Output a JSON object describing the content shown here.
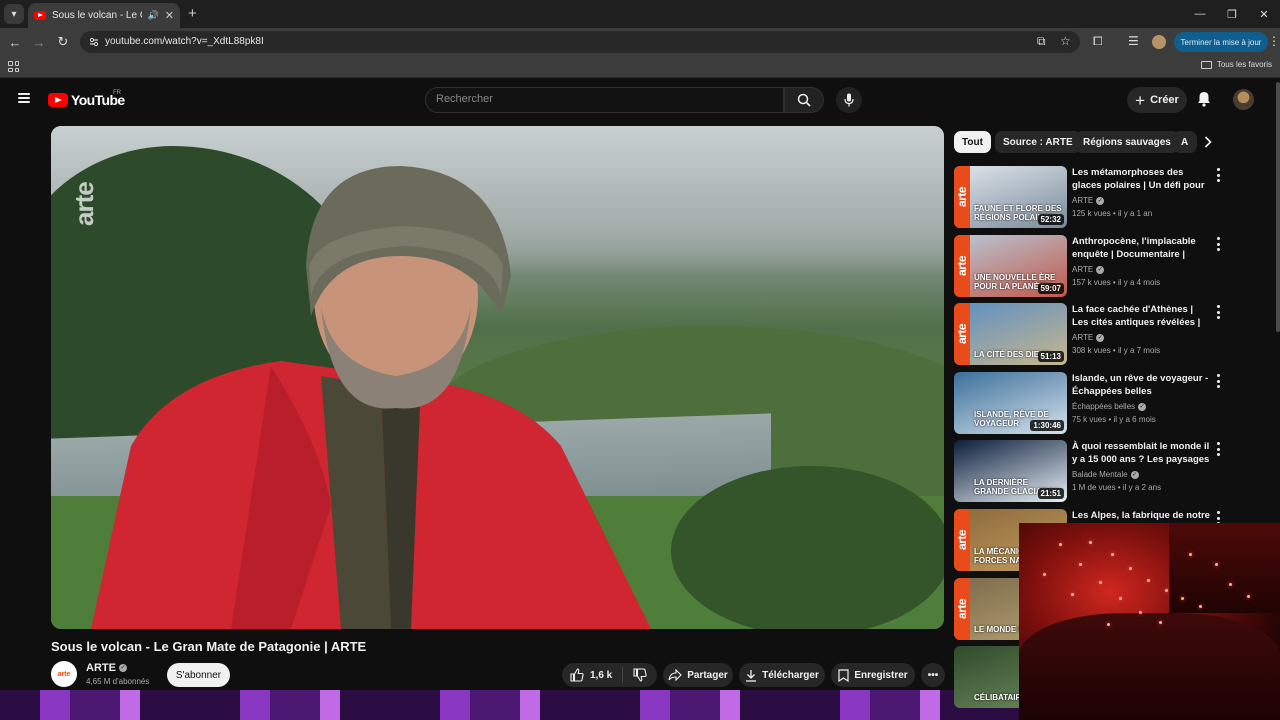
{
  "browser": {
    "tab_title": "Sous le volcan - Le Gran Mate",
    "url": "youtube.com/watch?v=_XdtL88pk8I",
    "update_label": "Terminer la mise à jour",
    "bookmarks_folder": "Tous les favoris"
  },
  "masthead": {
    "logo_text": "YouTube",
    "country": "FR",
    "search_placeholder": "Rechercher",
    "create_label": "Créer"
  },
  "video": {
    "title": "Sous le volcan - Le Gran Mate de Patagonie | ARTE",
    "watermark": "arte",
    "channel": {
      "name": "ARTE",
      "avatar_text": "arte",
      "subscribers": "4,65 M d'abonnés",
      "subscribe_label": "S'abonner"
    },
    "actions": {
      "likes": "1,6 k",
      "share": "Partager",
      "download": "Télécharger",
      "save": "Enregistrer"
    }
  },
  "chips": [
    "Tout",
    "Source : ARTE",
    "Régions sauvages",
    "A"
  ],
  "recommendations": [
    {
      "title": "Les métamorphoses des glaces polaires | Un défi pour les ...",
      "channel": "ARTE",
      "stats": "125 k vues • il y a 1 an",
      "duration": "52:32",
      "thumb_text": "FAUNE ET FLORE DES RÉGIONS POLAIRES",
      "arte": true,
      "colors": [
        "#dfe6ec",
        "#7a8a9a"
      ]
    },
    {
      "title": "Anthropocène, l'implacable enquête | Documentaire | ARTE",
      "channel": "ARTE",
      "stats": "157 k vues • il y a 4 mois",
      "duration": "59:07",
      "thumb_text": "UNE NOUVELLE ÈRE POUR LA PLANÈTE",
      "arte": true,
      "colors": [
        "#b8c7d6",
        "#c2584a"
      ]
    },
    {
      "title": "La face cachée d'Athènes | Les cités antiques révélées | ARTE",
      "channel": "ARTE",
      "stats": "308 k vues • il y a 7 mois",
      "duration": "51:13",
      "thumb_text": "LA CITÉ DES DIEUX",
      "arte": true,
      "colors": [
        "#5c8fc4",
        "#c7b68e"
      ]
    },
    {
      "title": "Islande, un rêve de voyageur - Échappées belles",
      "channel": "Échappées belles",
      "stats": "75 k vues • il y a 6 mois",
      "duration": "1:30:46",
      "thumb_text": "ISLANDE, RÊVE DE VOYAGEUR",
      "arte": false,
      "colors": [
        "#3b6f9c",
        "#d6e2ea"
      ]
    },
    {
      "title": "À quoi ressemblait le monde il y a 15 000 ans ? Les paysages ...",
      "channel": "Balade Mentale",
      "stats": "1 M de vues • il y a 2 ans",
      "duration": "21:51",
      "thumb_text": "LA DERNIÈRE GRANDE GLACIATION",
      "arte": false,
      "colors": [
        "#0b1e3b",
        "#e8eef4"
      ]
    },
    {
      "title": "Les Alpes, la fabrique de notre",
      "channel": "",
      "stats": "",
      "duration": "",
      "thumb_text": "LA MÉCANIQUE DES FORCES NATURELLES",
      "arte": true,
      "colors": [
        "#8b6a3c",
        "#c39a5c"
      ]
    },
    {
      "title": "",
      "channel": "",
      "stats": "",
      "duration": "",
      "thumb_text": "LE MONDE DES RATS",
      "arte": true,
      "colors": [
        "#7c6a4c",
        "#b4a070"
      ]
    },
    {
      "title": "",
      "channel": "",
      "stats": "",
      "duration": "",
      "thumb_text": "CÉLIBATAIR",
      "arte": false,
      "colors": [
        "#2f4a2c",
        "#6c8a5c"
      ]
    }
  ]
}
